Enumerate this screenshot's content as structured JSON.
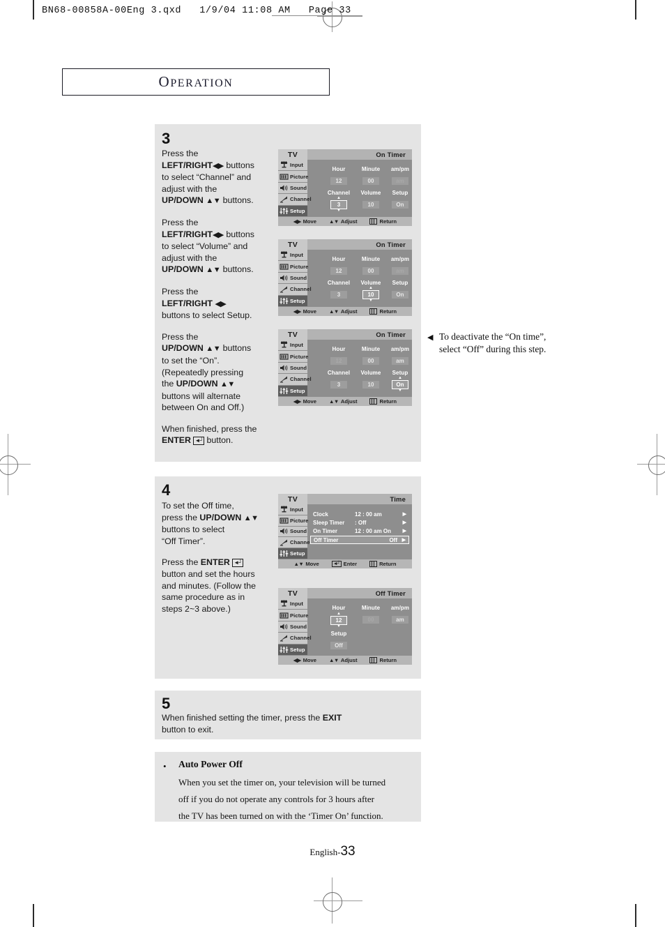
{
  "file_header": "BN68-00858A-00Eng 3.qxd   1/9/04 11:08 AM   Page 33",
  "chapter_title": {
    "cap": "O",
    "rest": "PERATION"
  },
  "steps": [
    {
      "number": "3",
      "paragraphs": [
        "Press the |LEFT/RIGHT|<>| buttons to select “Channel” and adjust with the |UP/DOWN|^v| buttons.",
        "Press the |LEFT/RIGHT|<>| buttons to select “Volume” and adjust with the |UP/DOWN|^v| buttons.",
        "Press the |LEFT/RIGHT|<>| buttons to select Setup.",
        "Press the |UP/DOWN|^v| buttons to set the “On”. (Repeatedly pressing the |UP/DOWN|^v| buttons will alternate between On and Off.)",
        "When finished, press the |ENTER|enter| button."
      ]
    },
    {
      "number": "4",
      "paragraphs": [
        "To set the Off time, press the |UP/DOWN|^v| buttons to select “Off Timer”.",
        "Press the |ENTER|enter| button and set the hours and minutes. (Follow the same procedure as in steps 2~3 above.)"
      ]
    },
    {
      "number": "5",
      "text_line1": "When finished setting the timer, press the ",
      "text_bold": "EXIT",
      "text_line2": "button to exit."
    }
  ],
  "step3_text": {
    "p1_a": "Press the",
    "p1_b": "LEFT/RIGHT",
    "p1_c": "buttons",
    "p1_d": "to select “Channel” and",
    "p1_e": "adjust with the",
    "p1_f": "UP/DOWN",
    "p1_g": "buttons.",
    "p2_a": "Press the",
    "p2_b": "LEFT/RIGHT",
    "p2_c": "buttons",
    "p2_d": "to select “Volume” and",
    "p2_e": "adjust with the",
    "p2_f": "UP/DOWN",
    "p2_g": "buttons.",
    "p3_a": "Press the",
    "p3_b": "LEFT/RIGHT",
    "p3_c": "buttons to select Setup.",
    "p4_a": "Press the",
    "p4_b": "UP/DOWN",
    "p4_c": "buttons",
    "p4_d": "to set the “On”.",
    "p4_e": "(Repeatedly pressing",
    "p4_f": "the",
    "p4_g": "UP/DOWN",
    "p4_h": "buttons will alternate",
    "p4_i": "between On and Off.)",
    "p5_a": "When finished, press the",
    "p5_b": "ENTER",
    "p5_c": "button."
  },
  "step4_text": {
    "p1_a": "To set the Off time,",
    "p1_b": "press the",
    "p1_c": "UP/DOWN",
    "p1_d": "buttons to select",
    "p1_e": "“Off Timer”.",
    "p2_a": "Press the",
    "p2_b": "ENTER",
    "p2_c": "button and set the hours",
    "p2_d": "and minutes. (Follow the",
    "p2_e": "same procedure as in",
    "p2_f": "steps 2~3 above.)"
  },
  "step5_text": {
    "a": "When finished setting the timer, press the",
    "b": "EXIT",
    "c": "button to exit."
  },
  "side_note": {
    "marker": "◀",
    "line1": "To deactivate the “On time”,",
    "line2": "select “Off” during this step."
  },
  "auto_power_off": {
    "bullet": "•",
    "title": "Auto Power Off",
    "line1": "When you set the timer on, your television will be turned",
    "line2": "off if you do not operate any controls for 3 hours after",
    "line3": "the TV has been turned on with the ‘Timer On’ function."
  },
  "osd_common": {
    "source_label": "TV",
    "sidebar": [
      {
        "label": "Input",
        "icon": "input-jack-icon"
      },
      {
        "label": "Picture",
        "icon": "picture-screen-icon"
      },
      {
        "label": "Sound",
        "icon": "speaker-icon"
      },
      {
        "label": "Channel",
        "icon": "antenna-icon"
      },
      {
        "label": "Setup",
        "icon": "sliders-icon"
      }
    ],
    "statusbar": {
      "move": "Move",
      "adjust": "Adjust",
      "enter": "Enter",
      "return": "Return",
      "move_glyph": "◀▶",
      "adjust_glyph": "▲▼"
    },
    "arrow_up": "▲",
    "arrow_down": "▼",
    "arrow_right": "▶"
  },
  "osd_panels": [
    {
      "id": "on-timer-channel",
      "title": "On Timer",
      "active_sidebar": 4,
      "statusbar_mode": "adjust",
      "labels": {
        "hour": "Hour",
        "minute": "Minute",
        "ampm": "am/pm",
        "channel": "Channel",
        "volume": "Volume",
        "setup": "Setup"
      },
      "values": {
        "hour": "12",
        "minute": "00",
        "ampm": "am",
        "channel": "3",
        "volume": "10",
        "setup": "On"
      },
      "dim": [
        "ampm"
      ],
      "selected": "channel"
    },
    {
      "id": "on-timer-volume",
      "title": "On Timer",
      "active_sidebar": 4,
      "statusbar_mode": "adjust",
      "labels": {
        "hour": "Hour",
        "minute": "Minute",
        "ampm": "am/pm",
        "channel": "Channel",
        "volume": "Volume",
        "setup": "Setup"
      },
      "values": {
        "hour": "12",
        "minute": "00",
        "ampm": "am",
        "channel": "3",
        "volume": "10",
        "setup": "On"
      },
      "dim": [
        "ampm"
      ],
      "selected": "volume"
    },
    {
      "id": "on-timer-setup",
      "title": "On Timer",
      "active_sidebar": 4,
      "statusbar_mode": "adjust",
      "labels": {
        "hour": "Hour",
        "minute": "Minute",
        "ampm": "am/pm",
        "channel": "Channel",
        "volume": "Volume",
        "setup": "Setup"
      },
      "values": {
        "hour": "12",
        "minute": "00",
        "ampm": "am",
        "channel": "3",
        "volume": "10",
        "setup": "On"
      },
      "dim": [
        "hour"
      ],
      "selected": "setup"
    },
    {
      "id": "off-timer-hour",
      "title": "Off Timer",
      "active_sidebar": 4,
      "statusbar_mode": "adjust",
      "labels": {
        "hour": "Hour",
        "minute": "Minute",
        "ampm": "am/pm",
        "setup": "Setup"
      },
      "values": {
        "hour": "12",
        "minute": "00",
        "ampm": "am",
        "setup": "Off"
      },
      "dim": [
        "minute"
      ],
      "selected": "hour"
    }
  ],
  "time_panel": {
    "id": "time-menu",
    "title": "Time",
    "active_sidebar": 4,
    "statusbar_mode": "enter",
    "rows": [
      {
        "name": "Clock",
        "value": "12 : 00   am",
        "selected": false
      },
      {
        "name": "Sleep Timer",
        "value": ":    Off",
        "selected": false
      },
      {
        "name": "On Timer",
        "value": "12 : 00   am On",
        "selected": false
      },
      {
        "name": "Off Timer",
        "value": "Off",
        "selected": true
      }
    ]
  },
  "footer": {
    "language": "English-",
    "page": "33"
  },
  "colors": {
    "panel_bg": "#e4e4e4",
    "osd_bg": "#8e8e8e",
    "osd_header": "#b3b3b3",
    "osd_sidebar": "#c9c9c9",
    "osd_active": "#5e5e5e",
    "osd_value_bg": "#9d9d9d",
    "text": "#1a1a1a"
  }
}
